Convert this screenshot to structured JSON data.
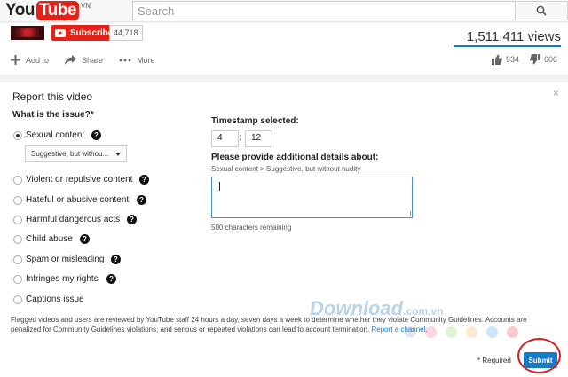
{
  "header": {
    "logo_you": "You",
    "logo_tube": "Tube",
    "logo_region": "VN",
    "search_placeholder": "Search",
    "search_icon": "magnifier-icon"
  },
  "video": {
    "subscribe_label": "Subscribe",
    "subscriber_count": "44,718",
    "views": "1,511,411 views",
    "add_to": "Add to",
    "share": "Share",
    "more": "More",
    "likes": "934",
    "dislikes": "606"
  },
  "report": {
    "title": "Report this video",
    "question": "What is the issue?*",
    "options": [
      {
        "label": "Sexual content",
        "selected": true
      },
      {
        "label": "Violent or repulsive content",
        "selected": false
      },
      {
        "label": "Hateful or abusive content",
        "selected": false
      },
      {
        "label": "Harmful dangerous acts",
        "selected": false
      },
      {
        "label": "Child abuse",
        "selected": false
      },
      {
        "label": "Spam or misleading",
        "selected": false
      },
      {
        "label": "Infringes my rights",
        "selected": false
      },
      {
        "label": "Captions issue",
        "selected": false
      }
    ],
    "subcategory": "Suggestive, but withou...",
    "timestamp_label": "Timestamp selected:",
    "timestamp_minutes": "4",
    "timestamp_separator": ":",
    "timestamp_seconds": "12",
    "details_label": "Please provide additional details about:",
    "details_context": "Sexual content > Suggestive, but without nudity",
    "details_value": "",
    "chars_remaining": "500 characters remaining",
    "notice": "Flagged videos and users are reviewed by YouTube staff 24 hours a day, seven days a week to determine whether they violate Community Guidelines. Accounts are penalized for Community Guidelines violations, and serious or repeated violations can lead to account termination.",
    "report_channel_link": "Report a channel.",
    "required_note": "* Required",
    "submit_label": "Submit",
    "close_symbol": "×"
  },
  "watermark": {
    "text": "Download",
    "suffix": ".com.vn"
  },
  "colors": {
    "brand_red": "#e62117",
    "link_blue": "#167ac6",
    "highlight_circle": "#d42020",
    "dots": [
      "#cfd8e8",
      "#f4b7c6",
      "#c9e6b1",
      "#f7d9a8",
      "#9ccff0",
      "#f4a0a8"
    ]
  }
}
